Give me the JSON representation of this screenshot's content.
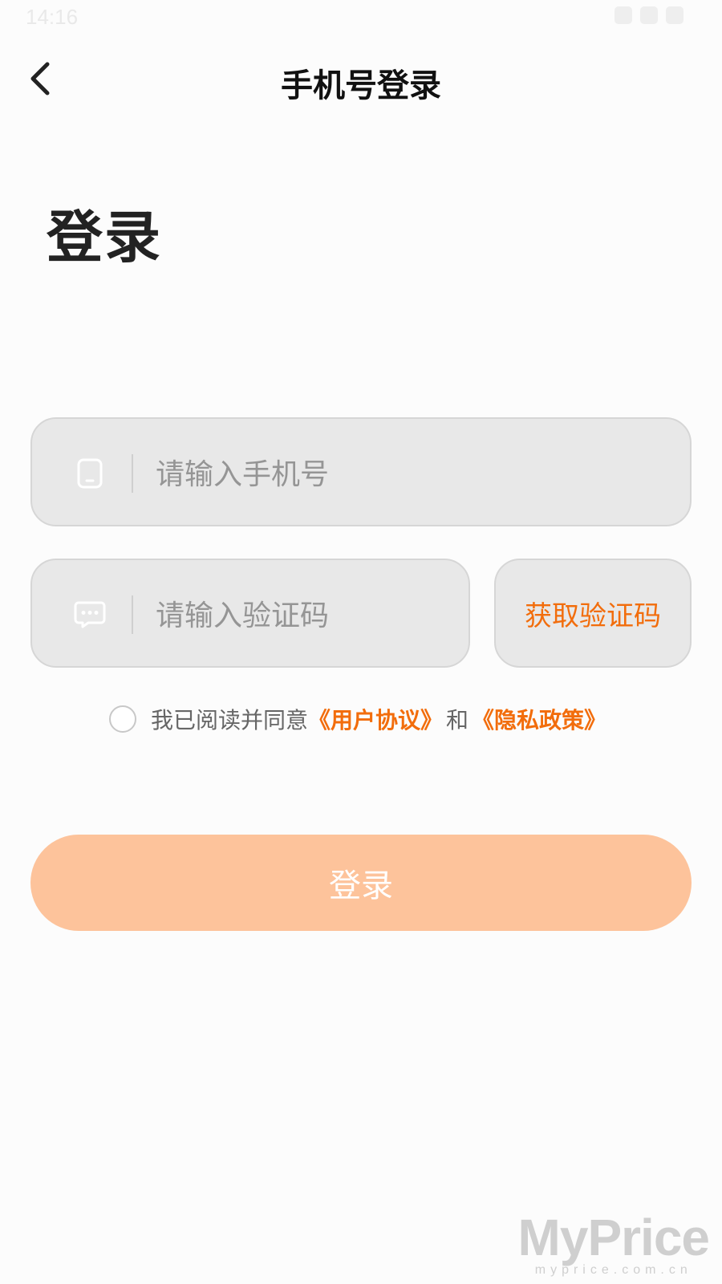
{
  "status_bar": {
    "time": "14:16"
  },
  "nav": {
    "title": "手机号登录",
    "back_icon": "chevron-left-icon"
  },
  "page": {
    "title": "登录"
  },
  "phone_field": {
    "icon": "phone-icon",
    "value": "",
    "placeholder": "请输入手机号"
  },
  "code_field": {
    "icon": "message-icon",
    "value": "",
    "placeholder": "请输入验证码"
  },
  "get_code_button": {
    "label": "获取验证码"
  },
  "agreement": {
    "checked": false,
    "prefix": "我已阅读并同意",
    "user_agreement": "《用户协议》",
    "and": "和",
    "privacy_policy": "《隐私政策》"
  },
  "login_button": {
    "label": "登录"
  },
  "watermark": {
    "logo": "MyPrice",
    "sub": "myprice.com.cn"
  },
  "colors": {
    "accent": "#f26d0c",
    "login_button_bg": "#fdc39b",
    "field_bg": "#e8e8e8"
  }
}
